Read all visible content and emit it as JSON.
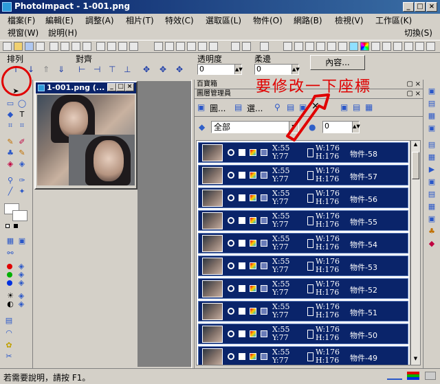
{
  "window": {
    "title": "PhotoImpact - 1-001.png"
  },
  "menu": [
    {
      "label": "檔案(F)"
    },
    {
      "label": "編輯(E)"
    },
    {
      "label": "調整(A)"
    },
    {
      "label": "相片(T)"
    },
    {
      "label": "特效(C)"
    },
    {
      "label": "選取區(L)"
    },
    {
      "label": "物件(O)"
    },
    {
      "label": "網路(B)"
    },
    {
      "label": "檢視(V)"
    },
    {
      "label": "工作區(K)"
    },
    {
      "label": "視窗(W)"
    },
    {
      "label": "說明(H)"
    },
    {
      "label": "切換(S)"
    }
  ],
  "attr": {
    "arrange_label": "排列",
    "align_label": "對齊",
    "transparency_label": "透明度",
    "transparency_value": "0",
    "soft_edge_label": "柔邊",
    "soft_edge_value": "0",
    "content_button": "內容..."
  },
  "document": {
    "title": "1-001.png (..."
  },
  "panels": {
    "treasure_title": "百寶箱",
    "layer_manager_title": "圖層管理員",
    "tab_image": "圖...",
    "tab_select": "選...",
    "filter_value": "全部",
    "opacity_value": "0"
  },
  "layers": [
    {
      "x": "X:55",
      "y": "Y:77",
      "w": "W:176",
      "h": "H:176",
      "name": "物件-58"
    },
    {
      "x": "X:55",
      "y": "Y:77",
      "w": "W:176",
      "h": "H:176",
      "name": "物件-57"
    },
    {
      "x": "X:55",
      "y": "Y:77",
      "w": "W:176",
      "h": "H:176",
      "name": "物件-56"
    },
    {
      "x": "X:55",
      "y": "Y:77",
      "w": "W:176",
      "h": "H:176",
      "name": "物件-55"
    },
    {
      "x": "X:55",
      "y": "Y:77",
      "w": "W:176",
      "h": "H:176",
      "name": "物件-54"
    },
    {
      "x": "X:55",
      "y": "Y:77",
      "w": "W:176",
      "h": "H:176",
      "name": "物件-53"
    },
    {
      "x": "X:55",
      "y": "Y:77",
      "w": "W:176",
      "h": "H:176",
      "name": "物件-52"
    },
    {
      "x": "X:55",
      "y": "Y:77",
      "w": "W:176",
      "h": "H:176",
      "name": "物件-51"
    },
    {
      "x": "X:55",
      "y": "Y:77",
      "w": "W:176",
      "h": "H:176",
      "name": "物件-50"
    },
    {
      "x": "X:55",
      "y": "Y:77",
      "w": "W:176",
      "h": "H:176",
      "name": "物件-49"
    }
  ],
  "status": {
    "help_text": "若需要說明，請按 F1。"
  },
  "annotation": {
    "text": "要修改一下座標",
    "color": "#e00000"
  },
  "colors": {
    "title_bar": "#0a246a",
    "selected_row": "#0a246a"
  }
}
